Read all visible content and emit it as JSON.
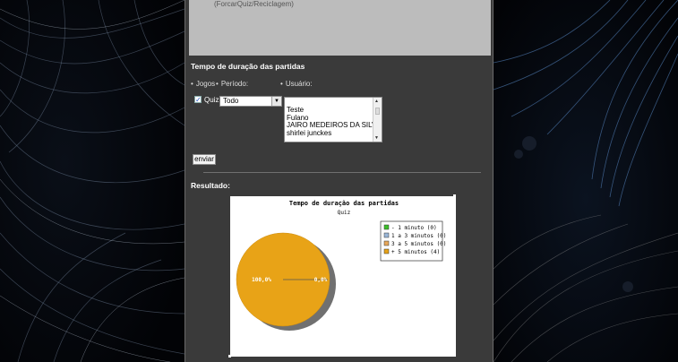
{
  "top_box": {
    "caption": "(ForcarQuiz/Reciclagem)"
  },
  "section": {
    "title": "Tempo de duração das partidas"
  },
  "filters": {
    "games_label": "Jogos",
    "period_label": "Período:",
    "user_label": "Usuário:",
    "quiz_checkbox_label": "Quiz",
    "quiz_checked": true,
    "period_selected": "Todo",
    "users": [
      "Teste",
      "Fulano",
      "JAIRO MEDEIROS DA SILVA",
      "shirlei junckes"
    ]
  },
  "submit_label": "enviar",
  "result": {
    "title": "Resultado:"
  },
  "chart_data": {
    "type": "pie",
    "title": "Tempo de duração das partidas",
    "subtitle": "Quiz",
    "legend_position": "top-right",
    "categories": [
      "- 1 minuto",
      "1 a 3 minutos",
      "3 a 5 minutos",
      "+ 5 minutos"
    ],
    "values": [
      0,
      0,
      0,
      4
    ],
    "legend_entries": [
      "- 1 minuto (0)",
      "1 a 3 minutos (0)",
      "3 a 5 minutos (0)",
      "+ 5 minutos (4)"
    ],
    "slice_labels": [
      "100,0%",
      "0,0%"
    ],
    "colors": [
      "#3cbf2a",
      "#9ab6d8",
      "#e8a85a",
      "#e8a317"
    ]
  }
}
